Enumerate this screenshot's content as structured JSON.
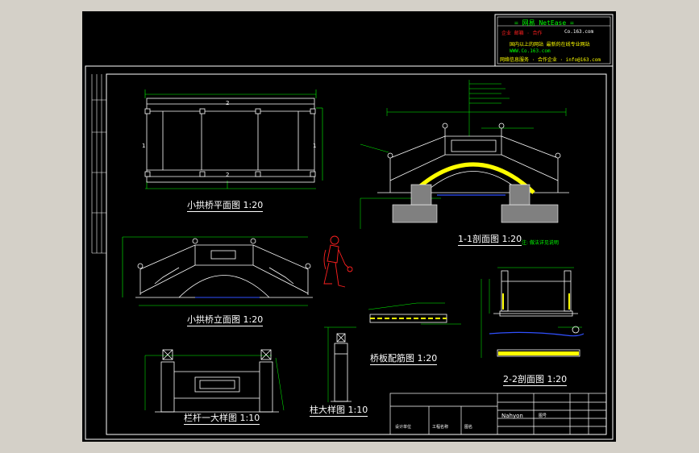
{
  "stamp": {
    "brand": "= 网易 NetEase =",
    "line1_left": "企业 邮箱 · 合作",
    "line1_right": "Co.163.com",
    "line2": "国内以上的网站 最新的在线专业网站",
    "line3": "WWW.Co.163.com",
    "line4": "网络信息服务 · 合作企业 · info@163.com"
  },
  "views": {
    "plan_title": "小拱桥平面图 1:20",
    "elevation_title": "小拱桥立面图 1:20",
    "section11_title": "1-1剖面图 1:20",
    "section22_title": "2-2剖面图 1:20",
    "rebar_title": "桥板配筋图 1:20",
    "railing_title": "栏杆一大样图 1:10",
    "column_title": "柱大样图 1:10"
  },
  "section_marks": {
    "plan_top": "2",
    "plan_bottom": "2",
    "plan_left": "1",
    "plan_right": "1"
  },
  "notes": {
    "section_note": "注: 做法详见说明"
  },
  "title_block": {
    "cell_a": "设计单位",
    "cell_b": "工程名称",
    "cell_c": "图名",
    "cell_d": "Nahyon",
    "cell_e": "图号"
  },
  "colors": {
    "background": "#000000",
    "frame": "#ffffff",
    "dimension": "#00ff00",
    "figure": "#ff2020",
    "hatch": "#ffff00",
    "water": "#3050ff",
    "detail": "#ff00ff"
  }
}
